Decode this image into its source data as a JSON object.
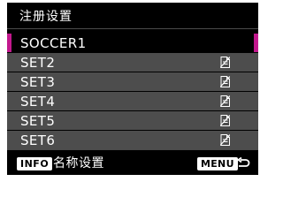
{
  "header": {
    "title": "注册设置"
  },
  "list": {
    "items": [
      {
        "label": "SOCCER1",
        "selected": true,
        "icon": null
      },
      {
        "label": "SET2",
        "selected": false,
        "icon": "no-data-icon"
      },
      {
        "label": "SET3",
        "selected": false,
        "icon": "no-data-icon"
      },
      {
        "label": "SET4",
        "selected": false,
        "icon": "no-data-icon"
      },
      {
        "label": "SET5",
        "selected": false,
        "icon": "no-data-icon"
      },
      {
        "label": "SET6",
        "selected": false,
        "icon": "no-data-icon"
      }
    ]
  },
  "footer": {
    "info_button": "INFO",
    "info_label": "名称设置",
    "menu_button": "MENU",
    "back_icon": "return-arrow-icon"
  },
  "colors": {
    "screen_bg": "#000000",
    "row_bg": "#4d4d4d",
    "selection_accent": "#c2188d",
    "text": "#ffffff"
  }
}
